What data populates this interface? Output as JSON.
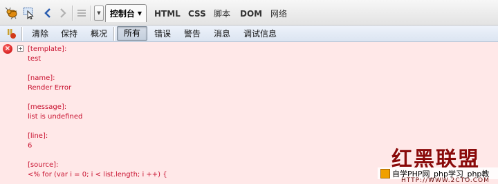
{
  "toolbar": {
    "tabs": [
      {
        "label": "HTML"
      },
      {
        "label": "CSS"
      },
      {
        "label": "脚本"
      },
      {
        "label": "DOM"
      },
      {
        "label": "网络"
      }
    ],
    "active_tab": {
      "label": "控制台"
    }
  },
  "console_toolbar": {
    "clear_label": "清除",
    "persist_label": "保持",
    "profile_label": "概况",
    "filters": [
      "所有",
      "错误",
      "警告",
      "消息",
      "调试信息"
    ]
  },
  "log": {
    "lines": [
      "[template]:",
      "test",
      "",
      "[name]:",
      "Render Error",
      "",
      "[message]:",
      "list is undefined",
      "",
      "[line]:",
      "6",
      "",
      "[source]:",
      "<% for (var i = 0; i < list.length; i ++) {"
    ]
  },
  "watermark": {
    "brand": "红黑联盟",
    "bar_text": "自学PHP网_php学习_php教",
    "url": "HTTP://WWW.2CTO.COM"
  },
  "colors": {
    "error_text": "#c8102e",
    "console_bg": "#ffe8e8"
  }
}
